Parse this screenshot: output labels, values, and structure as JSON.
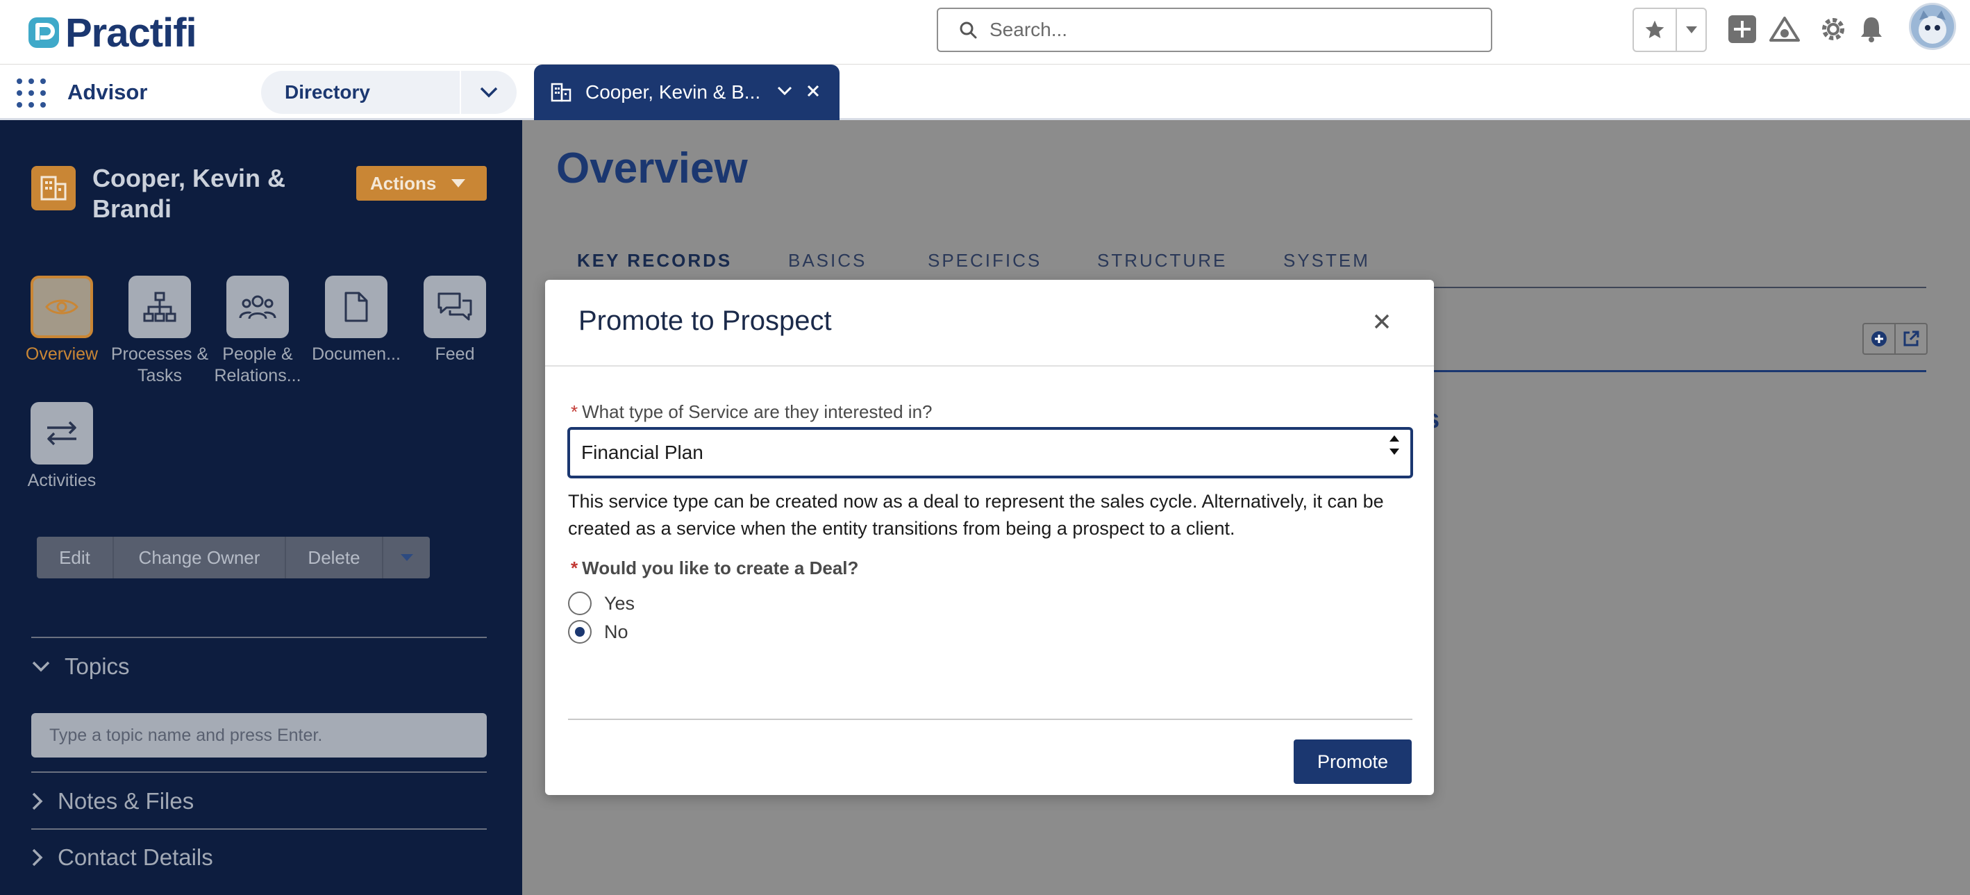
{
  "header": {
    "logo_text": "Practifi",
    "search_placeholder": "Search...",
    "icons": [
      "favorites-star-icon",
      "favorites-menu-icon",
      "add-icon",
      "trailhead-icon",
      "setup-gear-icon",
      "notifications-bell-icon",
      "user-avatar"
    ]
  },
  "nav": {
    "app_name": "Advisor",
    "object_selector": "Directory",
    "active_tab": "Cooper, Kevin & B..."
  },
  "record": {
    "name": "Cooper, Kevin & Brandi",
    "actions_label": "Actions",
    "tiles": [
      {
        "label": "Overview",
        "icon": "eye-icon",
        "active": true
      },
      {
        "label": "Processes & Tasks",
        "icon": "hierarchy-icon",
        "active": false
      },
      {
        "label": "People & Relations...",
        "icon": "people-icon",
        "active": false
      },
      {
        "label": "Documen...",
        "icon": "document-icon",
        "active": false
      },
      {
        "label": "Feed",
        "icon": "chat-icon",
        "active": false
      },
      {
        "label": "Activities",
        "icon": "swap-arrows-icon",
        "active": false
      }
    ],
    "buttons": [
      "Edit",
      "Change Owner",
      "Delete"
    ],
    "sections": {
      "topics": "Topics",
      "topic_placeholder": "Type a topic name and press Enter.",
      "notes": "Notes & Files",
      "contact": "Contact Details"
    }
  },
  "main": {
    "title": "Overview",
    "tabs": [
      "KEY RECORDS",
      "BASICS",
      "SPECIFICS",
      "STRUCTURE",
      "SYSTEM"
    ],
    "selected_tab": "KEY RECORDS",
    "peek_text": "s"
  },
  "modal": {
    "title": "Promote to Prospect",
    "question1": "What type of Service are they interested in?",
    "service_value": "Financial Plan",
    "help_text": "This service type can be created now as a deal to represent the sales cycle. Alternatively, it can be created as a service when the entity transitions from being a prospect to a client.",
    "question2": "Would you like to create a Deal?",
    "options": [
      "Yes",
      "No"
    ],
    "selected_option": "No",
    "required_marker": "*",
    "promote_label": "Promote"
  },
  "colors": {
    "brand_navy": "#1b3770",
    "sidebar_bg": "#0d1d3f",
    "accent_orange": "#c98635",
    "overlay_gray": "#8c8c8c"
  }
}
